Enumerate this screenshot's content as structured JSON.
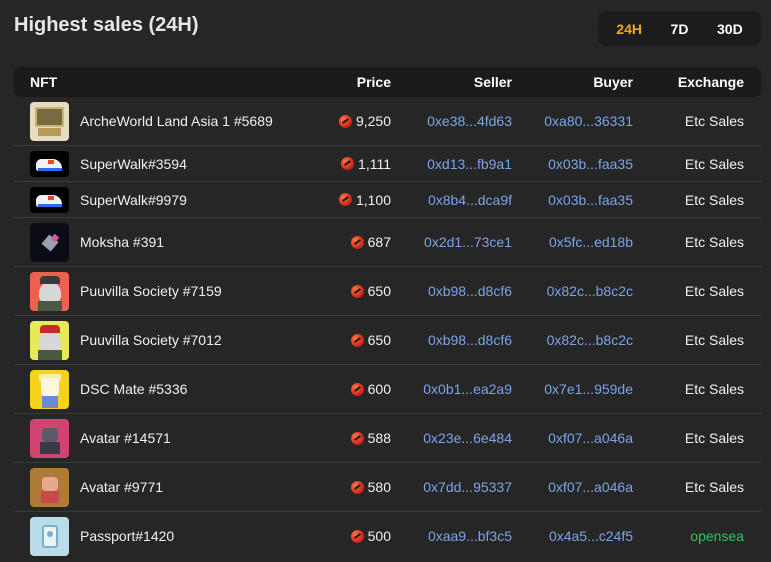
{
  "header": {
    "title": "Highest sales (24H)",
    "tabs": [
      {
        "label": "24H",
        "active": true
      },
      {
        "label": "7D",
        "active": false
      },
      {
        "label": "30D",
        "active": false
      }
    ]
  },
  "colors": {
    "background": "#262626",
    "active_tab": "#f0a81c",
    "address": "#7ba4e8",
    "opensea": "#2ec85a"
  },
  "columns": {
    "nft": "NFT",
    "price": "Price",
    "seller": "Seller",
    "buyer": "Buyer",
    "exchange": "Exchange"
  },
  "rows": [
    {
      "name": "ArcheWorld Land Asia 1 #5689",
      "price": "9,250",
      "seller": "0xe38...4fd63",
      "buyer": "0xa80...36331",
      "exchange": "Etc Sales"
    },
    {
      "name": "SuperWalk#3594",
      "price": "1,111",
      "seller": "0xd13...fb9a1",
      "buyer": "0x03b...faa35",
      "exchange": "Etc Sales"
    },
    {
      "name": "SuperWalk#9979",
      "price": "1,100",
      "seller": "0x8b4...dca9f",
      "buyer": "0x03b...faa35",
      "exchange": "Etc Sales"
    },
    {
      "name": "Moksha #391",
      "price": "687",
      "seller": "0x2d1...73ce1",
      "buyer": "0x5fc...ed18b",
      "exchange": "Etc Sales"
    },
    {
      "name": "Puuvilla Society #7159",
      "price": "650",
      "seller": "0xb98...d8cf6",
      "buyer": "0x82c...b8c2c",
      "exchange": "Etc Sales"
    },
    {
      "name": "Puuvilla Society #7012",
      "price": "650",
      "seller": "0xb98...d8cf6",
      "buyer": "0x82c...b8c2c",
      "exchange": "Etc Sales"
    },
    {
      "name": "DSC Mate #5336",
      "price": "600",
      "seller": "0x0b1...ea2a9",
      "buyer": "0x7e1...959de",
      "exchange": "Etc Sales"
    },
    {
      "name": "Avatar #14571",
      "price": "588",
      "seller": "0x23e...6e484",
      "buyer": "0xf07...a046a",
      "exchange": "Etc Sales"
    },
    {
      "name": "Avatar #9771",
      "price": "580",
      "seller": "0x7dd...95337",
      "buyer": "0xf07...a046a",
      "exchange": "Etc Sales"
    },
    {
      "name": "Passport#1420",
      "price": "500",
      "seller": "0xaa9...bf3c5",
      "buyer": "0x4a5...c24f5",
      "exchange": "opensea"
    }
  ]
}
